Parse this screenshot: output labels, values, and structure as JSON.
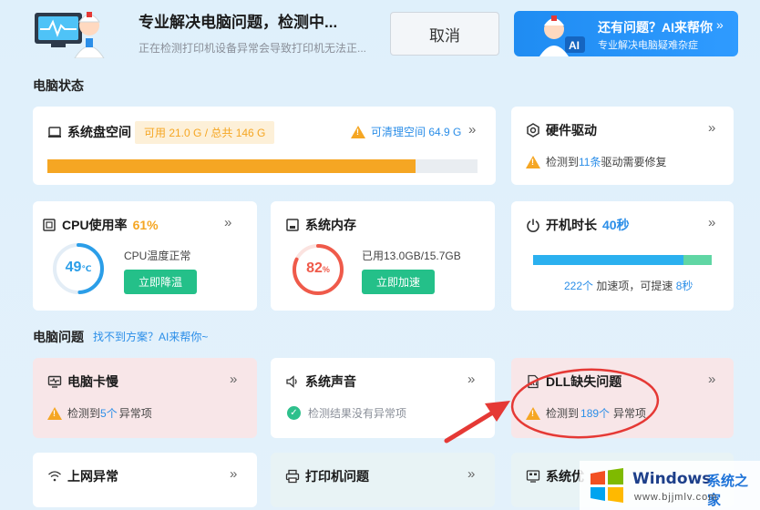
{
  "header": {
    "title": "专业解决电脑问题，检测中...",
    "subtitle": "正在检测打印机设备异常会导致打印机无法正...",
    "cancel_label": "取消",
    "ai_title": "还有问题？AI来帮你",
    "ai_chev": "»",
    "ai_subtitle": "专业解决电脑疑难杂症",
    "ai_badge": "AI"
  },
  "status_section": {
    "title": "电脑状态"
  },
  "disk": {
    "title": "系统盘空间",
    "usage": "可用 21.0 G / 总共 146 G",
    "cleanable": "可清理空间 64.9 G",
    "chev": "»",
    "used_fraction": 0.856
  },
  "hardware": {
    "title": "硬件驱动",
    "chev": "»",
    "pre": "检测到",
    "count": "11条",
    "post": "驱动需要修复"
  },
  "cpu": {
    "title": "CPU使用率",
    "percent": "61%",
    "chev": "»",
    "temp_value": "49",
    "temp_unit": "℃",
    "temp_text": "CPU温度正常",
    "button": "立即降温",
    "gauge_fraction": 0.49
  },
  "memory": {
    "title": "系统内存",
    "value": "82",
    "unit": "%",
    "usage": "已用13.0GB/15.7GB",
    "button": "立即加速",
    "gauge_fraction": 0.82
  },
  "boot": {
    "title": "开机时长",
    "seconds": "40秒",
    "chev": "»",
    "count": "222个",
    "mid": "加速项，可提速",
    "saving": "8秒",
    "bar_fraction": 0.84
  },
  "problems_section": {
    "title": "电脑问题",
    "link": "找不到方案？AI来帮你~"
  },
  "lag": {
    "title": "电脑卡慢",
    "chev": "»",
    "pre": "检测到",
    "count": "5个",
    "post": "异常项"
  },
  "sound": {
    "title": "系统声音",
    "chev": "»",
    "status": "检测结果没有异常项"
  },
  "dll": {
    "title": "DLL缺失问题",
    "chev": "»",
    "pre": "检测到",
    "count": "189个",
    "post": "异常项"
  },
  "network": {
    "title": "上网异常",
    "chev": "»"
  },
  "printer": {
    "title": "打印机问题",
    "chev": "»"
  },
  "sysopt": {
    "title": "系统优"
  },
  "watermark": {
    "brand": "Windows",
    "brand_cn": "系统之家",
    "url": "www.bjjmlv.com"
  },
  "colors": {
    "accent": "#2b8ee8",
    "warning": "#f5a623",
    "success": "#24c089",
    "danger": "#ef5a4a",
    "annotation": "#e53935"
  }
}
